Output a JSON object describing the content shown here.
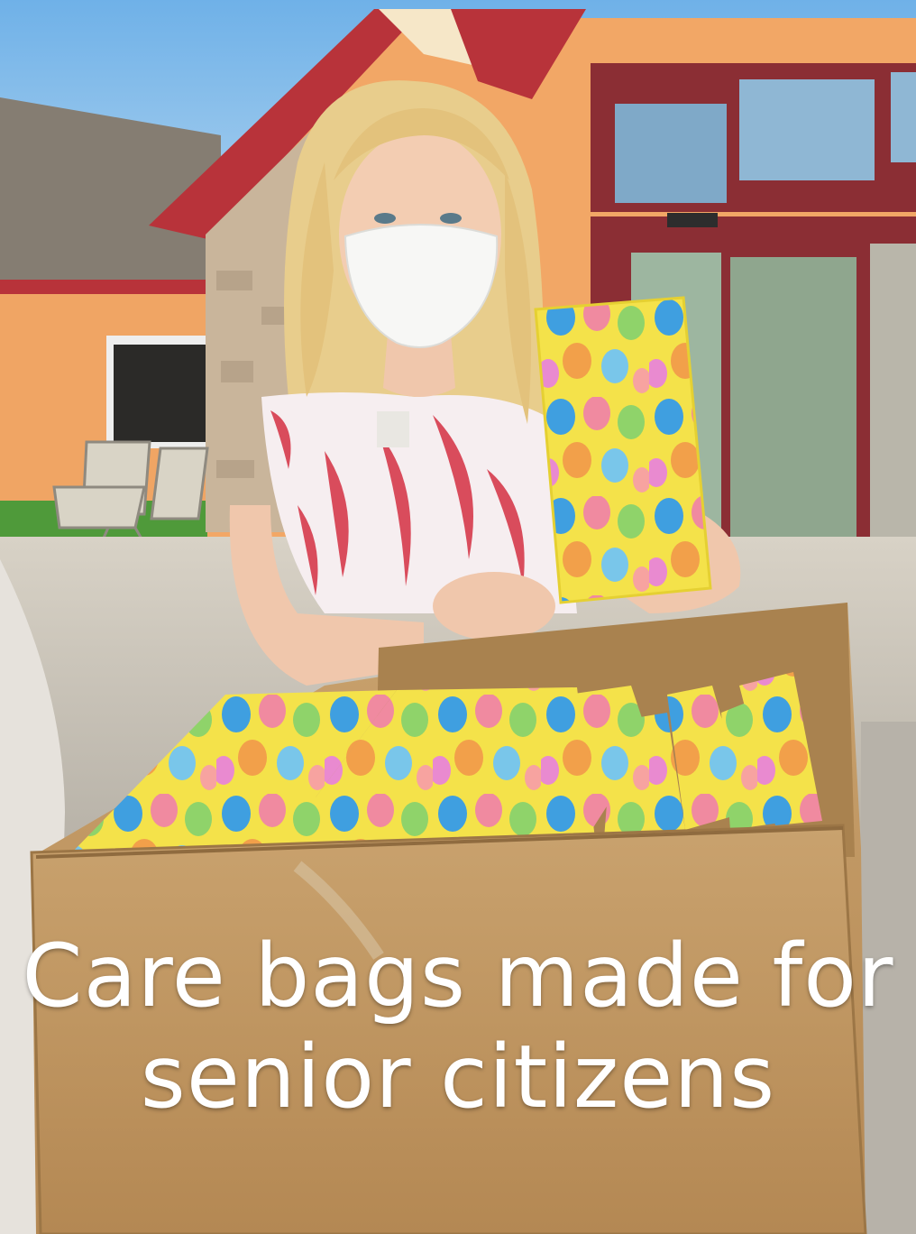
{
  "photo": {
    "subject": "woman-holding-easter-gift-bag",
    "colors": {
      "sky": "#8fc0e8",
      "building_wall": "#f2a766",
      "roof_trim": "#b8333a",
      "stone": "#c9b59b",
      "box": "#c69d6a",
      "bag_yellow": "#f4e24a",
      "bag_blue": "#3f9fe0",
      "bag_pink": "#f08aa0",
      "bag_green": "#8fd36a",
      "hair": "#e8cd8c",
      "mask": "#f7f7f5",
      "dress_print": "#d94c5c"
    }
  },
  "caption": {
    "line1": "Care bags made for",
    "line2": "senior citizens"
  }
}
